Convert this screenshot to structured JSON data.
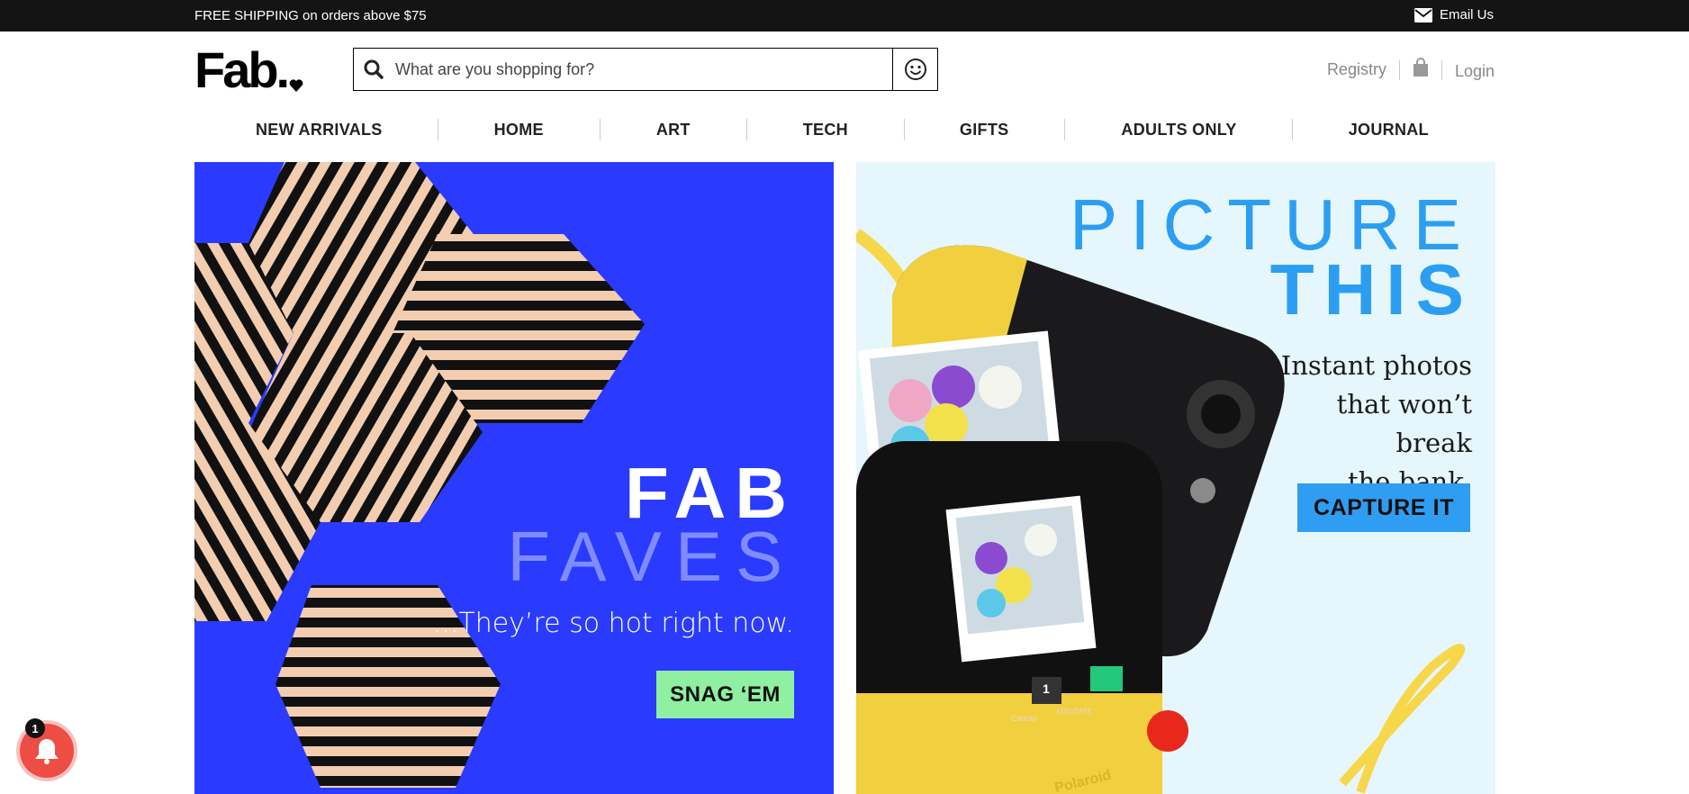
{
  "topbar": {
    "shipping_text": "FREE SHIPPING on orders above $75",
    "email_label": "Email Us",
    "email_icon": "envelope-icon"
  },
  "header": {
    "logo_text": "Fab.",
    "search": {
      "placeholder": "What are you shopping for?",
      "value": "",
      "search_icon": "search-icon",
      "emoji_icon": "smiley-icon"
    },
    "registry_label": "Registry",
    "cart_icon": "shopping-bag-icon",
    "login_label": "Login"
  },
  "nav": {
    "items": [
      {
        "label": "NEW ARRIVALS"
      },
      {
        "label": "HOME"
      },
      {
        "label": "ART"
      },
      {
        "label": "TECH"
      },
      {
        "label": "GIFTS"
      },
      {
        "label": "ADULTS ONLY"
      },
      {
        "label": "JOURNAL"
      }
    ]
  },
  "banners": {
    "left": {
      "title": "FAB",
      "subtitle": "FAVES",
      "tagline": "...They’re so hot right now.",
      "cta": "SNAG ‘EM",
      "background_color": "#2a3bff",
      "cta_color": "#8ef0a0"
    },
    "right": {
      "title_line1": "PICTURE",
      "title_line2": "THIS",
      "tagline_lines": [
        "Instant photos",
        "that won’t break",
        "the bank."
      ],
      "cta": "CAPTURE IT",
      "background_color": "#e6f6fd",
      "cta_color": "#2f9df1",
      "camera": {
        "quantity": "1",
        "cancel_label": "Cancel",
        "add_date_label": "ADD DATE",
        "brand": "Polaroid"
      }
    }
  },
  "notification": {
    "count": "1",
    "icon": "bell-icon"
  }
}
